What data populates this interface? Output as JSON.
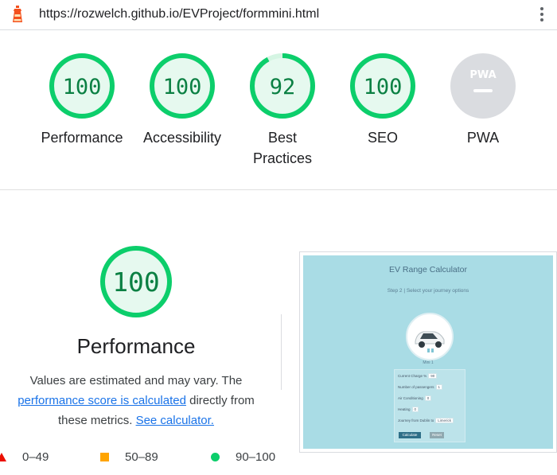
{
  "browser": {
    "url": "https://rozwelch.github.io/EVProject/formmini.html",
    "menu_icon": "kebab-menu-icon",
    "lighthouse_icon": "lighthouse-icon"
  },
  "colors": {
    "pass": "#0cce6b",
    "pass_text": "#0b8043",
    "average": "#ffa400",
    "fail": "#eb0f00",
    "pwa_gray": "#dadce0",
    "thumbnail_bg": "#a9dce5"
  },
  "scores": [
    {
      "label": "Performance",
      "value": "100",
      "fraction": 1.0
    },
    {
      "label": "Accessibility",
      "value": "100",
      "fraction": 1.0
    },
    {
      "label_line1": "Best",
      "label_line2": "Practices",
      "value": "92",
      "fraction": 0.92
    },
    {
      "label": "SEO",
      "value": "100",
      "fraction": 1.0
    },
    {
      "label": "PWA",
      "badge_text": "PWA"
    }
  ],
  "performance": {
    "score": "100",
    "fraction": 1.0,
    "title": "Performance",
    "desc_part1": "Values are estimated and may vary. The",
    "link_score": "performance score is calculated",
    "desc_part2": "directly from these metrics.",
    "link_calc": "See calculator."
  },
  "legend": {
    "fail_range": "0–49",
    "average_range": "50–89",
    "pass_range": "90–100"
  },
  "thumbnail": {
    "title": "EV Range Calculator",
    "step": "Step 2 | Select your journey options",
    "caption": "Mini 1",
    "rows": [
      {
        "label": "Current Charge %",
        "value": "90"
      },
      {
        "label": "Number of passengers",
        "value": "1"
      },
      {
        "label": "Air Conditioning",
        "value": "0"
      },
      {
        "label": "Heating",
        "value": "0"
      },
      {
        "label": "Journey from Dublin to",
        "value": "Limerick"
      }
    ],
    "calculate_label": "Calculate",
    "reset_label": "Reset"
  }
}
